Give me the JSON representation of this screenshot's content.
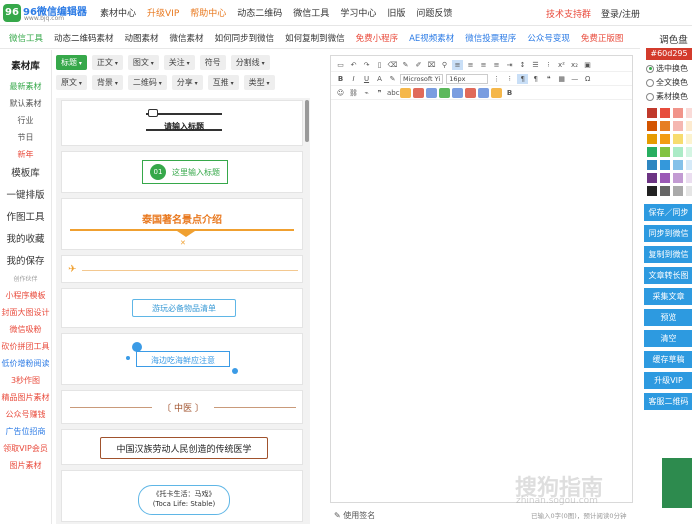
{
  "logo": {
    "badge": "96",
    "title": "96微信编辑器",
    "url": "www.bjq.com"
  },
  "nav": [
    "素材中心",
    "升级VIP",
    "帮助中心",
    "动态二维码",
    "微信工具",
    "学习中心",
    "旧版",
    "问题反馈"
  ],
  "top_right": {
    "support": "技术支持群",
    "login": "登录/注册"
  },
  "subnav": [
    "微信工具",
    "动态二维码素材",
    "动图素材",
    "微信素材",
    "如何同步到微信",
    "如何复制到微信",
    "免费小程序",
    "AE视频素材",
    "微信投票程序",
    "公众号变现",
    "免费正版图"
  ],
  "sidebar": [
    "素材库",
    "最新素材",
    "默认素材",
    "行业",
    "节日",
    "新年",
    "模板库",
    "一键排版",
    "作图工具",
    "我的收藏",
    "我的保存",
    "创作伙伴",
    "小程序模板",
    "封面大图设计",
    "微信吸粉",
    "砍价拼团工具",
    "低价增粉阅读",
    "3秒作图",
    "精品图片素材",
    "公众号赚钱",
    "广告位招商",
    "领取VIP会员",
    "图片素材"
  ],
  "filters": {
    "row1": [
      "标题",
      "正文",
      "图文",
      "关注",
      "符号",
      "分割线"
    ],
    "row2": [
      "原文",
      "背景",
      "二维码",
      "分享",
      "互推",
      "类型"
    ]
  },
  "templates": [
    {
      "text": "请输入标题"
    },
    {
      "num": "01",
      "text": "这里输入标题"
    },
    {
      "text": "泰国著名景点介绍"
    },
    {
      "text": ""
    },
    {
      "text": "游玩必备物品清单"
    },
    {
      "text": "海边吃海鲜应注意"
    },
    {
      "text": "〔 中医 〕"
    },
    {
      "text": "中国汉族劳动人民创造的传统医学"
    },
    {
      "line1": "《托卡生活：马戏》",
      "line2": "(Toca Life: Stable)"
    }
  ],
  "editor": {
    "font": "Microsoft Yi",
    "size": "16px",
    "footer_sign": "使用签名",
    "footer_count": "已输入0字(0图)，预计阅读0分钟"
  },
  "right_panel": {
    "title": "调色盘",
    "hex": "#60d295",
    "options": [
      "选中换色",
      "全文换色",
      "素材换色"
    ],
    "buttons": [
      "保存／同步",
      "同步到微信",
      "复制到微信",
      "文章转长图",
      "采集文章",
      "预览",
      "清空",
      "缓存草稿",
      "升级VIP",
      "客服二维码"
    ]
  },
  "watermark": {
    "main": "搜狗指南",
    "sub": "zhinan.sogou.com"
  },
  "colors": {
    "accent": "#36a84a",
    "panel_hex": "#60d295",
    "button_blue": "#2d9ae0",
    "orange": "#e8781e",
    "red": "#e94b3c"
  }
}
